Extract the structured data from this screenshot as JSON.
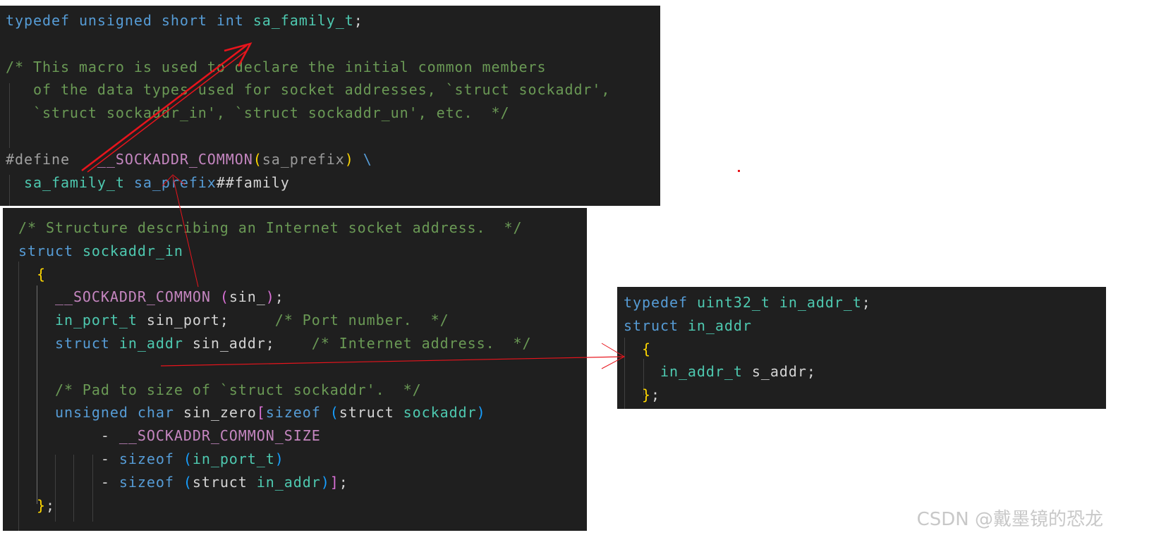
{
  "panels": [
    {
      "name": "sa-family-typedef-panel",
      "lines": [
        [
          {
            "t": "typedef ",
            "c": "kw"
          },
          {
            "t": "unsigned ",
            "c": "kw"
          },
          {
            "t": "short ",
            "c": "kw"
          },
          {
            "t": "int ",
            "c": "kw"
          },
          {
            "t": "sa_family_t",
            "c": "ty"
          },
          {
            "t": ";",
            "c": "pl"
          }
        ],
        [],
        [
          {
            "t": "/* This macro is used to declare the initial common members",
            "c": "cm"
          }
        ],
        [
          {
            "t": "   of the data types used for socket addresses, `struct sockaddr',",
            "c": "cm"
          }
        ],
        [
          {
            "t": "   `struct sockaddr_in', `struct sockaddr_un', etc.  */",
            "c": "cm"
          }
        ],
        [],
        [
          {
            "t": "#define ",
            "c": "dim"
          },
          {
            "t": "  __SOCKADDR_COMMON",
            "c": "mc"
          },
          {
            "t": "(",
            "c": "br"
          },
          {
            "t": "sa_prefix",
            "c": "pm"
          },
          {
            "t": ")",
            "c": "br"
          },
          {
            "t": " \\",
            "c": "kw"
          }
        ],
        [
          {
            "t": "  sa_family_t ",
            "c": "ty"
          },
          {
            "t": "sa_prefix",
            "c": "kw"
          },
          {
            "t": "##family",
            "c": "pl"
          }
        ]
      ]
    },
    {
      "name": "sockaddr-in-panel",
      "lines": [
        [
          {
            "t": "/* Structure describing an Internet socket address.  */",
            "c": "cm"
          }
        ],
        [
          {
            "t": "struct ",
            "c": "kw"
          },
          {
            "t": "sockaddr_in",
            "c": "ty"
          }
        ],
        [
          {
            "t": "  ",
            "c": "pl"
          },
          {
            "t": "{",
            "c": "br"
          }
        ],
        [
          {
            "t": "    __SOCKADDR_COMMON ",
            "c": "mc"
          },
          {
            "t": "(",
            "c": "b2"
          },
          {
            "t": "sin_",
            "c": "pl"
          },
          {
            "t": ")",
            "c": "b2"
          },
          {
            "t": ";",
            "c": "pl"
          }
        ],
        [
          {
            "t": "    in_port_t ",
            "c": "ty"
          },
          {
            "t": "sin_port;     ",
            "c": "pl"
          },
          {
            "t": "/* Port number.  */",
            "c": "cm"
          }
        ],
        [
          {
            "t": "    struct ",
            "c": "kw"
          },
          {
            "t": "in_addr ",
            "c": "ty"
          },
          {
            "t": "sin_addr;    ",
            "c": "pl"
          },
          {
            "t": "/* Internet address.  */",
            "c": "cm"
          }
        ],
        [],
        [
          {
            "t": "    /* Pad to size of `struct sockaddr'.  */",
            "c": "cm"
          }
        ],
        [
          {
            "t": "    unsigned ",
            "c": "kw"
          },
          {
            "t": "char ",
            "c": "kw"
          },
          {
            "t": "sin_zero",
            "c": "pl"
          },
          {
            "t": "[",
            "c": "b2"
          },
          {
            "t": "sizeof ",
            "c": "kw"
          },
          {
            "t": "(",
            "c": "b3"
          },
          {
            "t": "struct ",
            "c": "pl"
          },
          {
            "t": "sockaddr",
            "c": "ty"
          },
          {
            "t": ")",
            "c": "b3"
          }
        ],
        [
          {
            "t": "         - ",
            "c": "pl"
          },
          {
            "t": "__SOCKADDR_COMMON_SIZE",
            "c": "mc"
          }
        ],
        [
          {
            "t": "         - ",
            "c": "pl"
          },
          {
            "t": "sizeof ",
            "c": "kw"
          },
          {
            "t": "(",
            "c": "b3"
          },
          {
            "t": "in_port_t",
            "c": "ty"
          },
          {
            "t": ")",
            "c": "b3"
          }
        ],
        [
          {
            "t": "         - ",
            "c": "pl"
          },
          {
            "t": "sizeof ",
            "c": "kw"
          },
          {
            "t": "(",
            "c": "b3"
          },
          {
            "t": "struct ",
            "c": "pl"
          },
          {
            "t": "in_addr",
            "c": "ty"
          },
          {
            "t": ")",
            "c": "b3"
          },
          {
            "t": "]",
            "c": "b2"
          },
          {
            "t": ";",
            "c": "pl"
          }
        ],
        [
          {
            "t": "  ",
            "c": "pl"
          },
          {
            "t": "}",
            "c": "br"
          },
          {
            "t": ";",
            "c": "pl"
          }
        ]
      ]
    },
    {
      "name": "in-addr-panel",
      "lines": [
        [
          {
            "t": "typedef ",
            "c": "kw"
          },
          {
            "t": "uint32_t ",
            "c": "ty"
          },
          {
            "t": "in_addr_t",
            "c": "ty"
          },
          {
            "t": ";",
            "c": "pl"
          }
        ],
        [
          {
            "t": "struct ",
            "c": "kw"
          },
          {
            "t": "in_addr",
            "c": "ty"
          }
        ],
        [
          {
            "t": "  ",
            "c": "pl"
          },
          {
            "t": "{",
            "c": "br"
          }
        ],
        [
          {
            "t": "    in_addr_t ",
            "c": "ty"
          },
          {
            "t": "s_addr;",
            "c": "pl"
          }
        ],
        [
          {
            "t": "  ",
            "c": "pl"
          },
          {
            "t": "}",
            "c": "br"
          },
          {
            "t": ";",
            "c": "pl"
          }
        ]
      ]
    }
  ],
  "annotation_color": "#e8141c",
  "watermark": "CSDN @戴墨镜的恐龙"
}
